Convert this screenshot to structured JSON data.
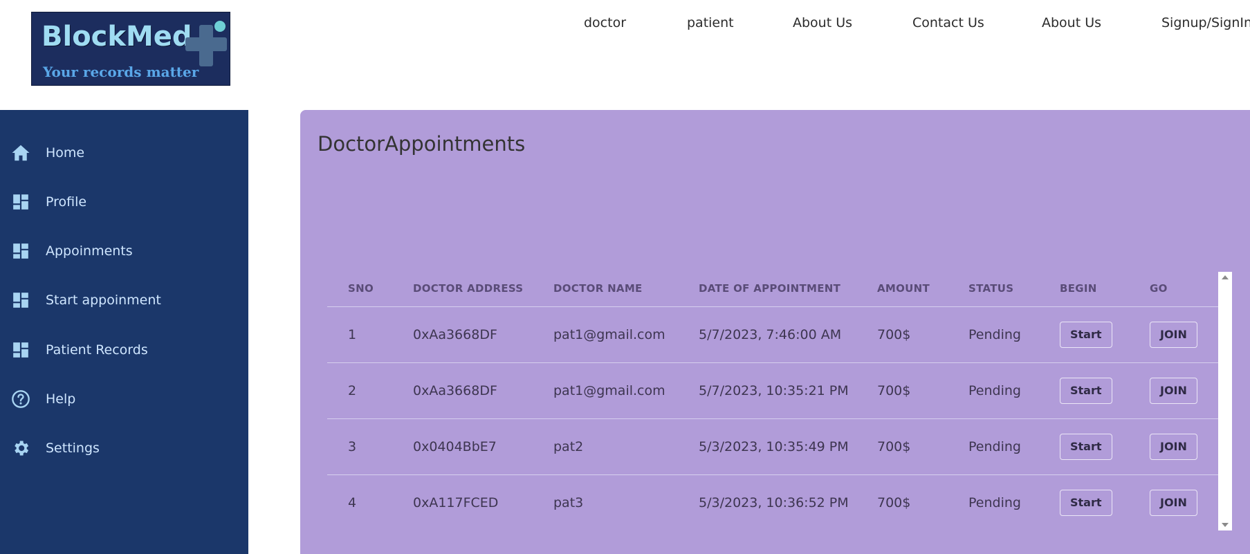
{
  "logo": {
    "title": "BlockMed",
    "tagline": "Your records matter"
  },
  "nav": [
    {
      "label": "doctor"
    },
    {
      "label": "patient"
    },
    {
      "label": "About Us"
    },
    {
      "label": "Contact Us"
    },
    {
      "label": "About Us"
    },
    {
      "label": "Signup/SignIn"
    }
  ],
  "sidebar": {
    "items": [
      {
        "label": "Home",
        "icon": "home-icon"
      },
      {
        "label": "Profile",
        "icon": "dashboard-icon"
      },
      {
        "label": "Appoinments",
        "icon": "dashboard-icon"
      },
      {
        "label": "Start appoinment",
        "icon": "dashboard-icon"
      },
      {
        "label": "Patient Records",
        "icon": "dashboard-icon"
      },
      {
        "label": "Help",
        "icon": "help-icon"
      },
      {
        "label": "Settings",
        "icon": "gear-icon"
      }
    ]
  },
  "main": {
    "title": "DoctorAppointments",
    "table": {
      "headers": [
        "SNO",
        "DOCTOR ADDRESS",
        "DOCTOR NAME",
        "DATE OF APPOINTMENT",
        "AMOUNT",
        "STATUS",
        "BEGIN",
        "GO"
      ],
      "rows": [
        {
          "sno": "1",
          "address": "0xAa3668DF",
          "name": "pat1@gmail.com",
          "date": "5/7/2023, 7:46:00 AM",
          "amount": "700$",
          "status": "Pending",
          "begin": "Start",
          "go": "JOIN"
        },
        {
          "sno": "2",
          "address": "0xAa3668DF",
          "name": "pat1@gmail.com",
          "date": "5/7/2023, 10:35:21 PM",
          "amount": "700$",
          "status": "Pending",
          "begin": "Start",
          "go": "JOIN"
        },
        {
          "sno": "3",
          "address": "0x0404BbE7",
          "name": "pat2",
          "date": "5/3/2023, 10:35:49 PM",
          "amount": "700$",
          "status": "Pending",
          "begin": "Start",
          "go": "JOIN"
        },
        {
          "sno": "4",
          "address": "0xA117FCED",
          "name": "pat3",
          "date": "5/3/2023, 10:36:52 PM",
          "amount": "700$",
          "status": "Pending",
          "begin": "Start",
          "go": "JOIN"
        }
      ]
    }
  },
  "colors": {
    "sidebar_bg": "#1b376a",
    "panel_bg": "#b19cd9",
    "logo_bg": "#1c2d5e",
    "sidebar_text": "#cfe6ff"
  }
}
